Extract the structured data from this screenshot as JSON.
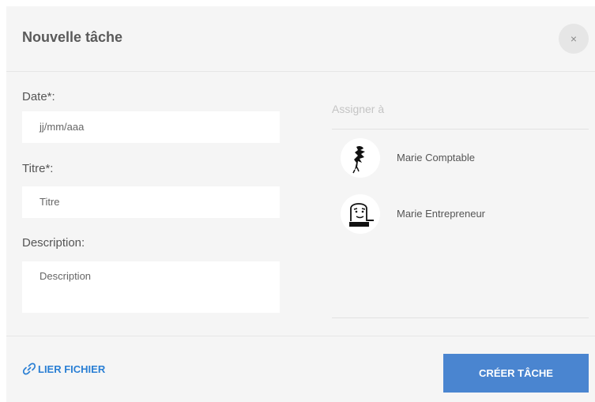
{
  "dialog": {
    "title": "Nouvelle tâche",
    "close_label": "×"
  },
  "form": {
    "date": {
      "label": "Date*:",
      "placeholder": "jj/mm/aaa"
    },
    "titre": {
      "label": "Titre*:",
      "placeholder": "Titre"
    },
    "description": {
      "label": "Description:",
      "placeholder": "Description"
    }
  },
  "assign": {
    "title": "Assigner à",
    "users": [
      {
        "name": "Marie Comptable",
        "avatar_icon": "dancing-figure-avatar-icon"
      },
      {
        "name": "Marie Entrepreneur",
        "avatar_icon": "cartoon-face-avatar-icon"
      }
    ]
  },
  "footer": {
    "link_label": "LIER FICHIER",
    "link_icon": "link-icon",
    "create_label": "CRÉER TÂCHE"
  },
  "colors": {
    "accent": "#4a85d0",
    "link": "#2a7fd4",
    "background": "#f5f5f5"
  }
}
